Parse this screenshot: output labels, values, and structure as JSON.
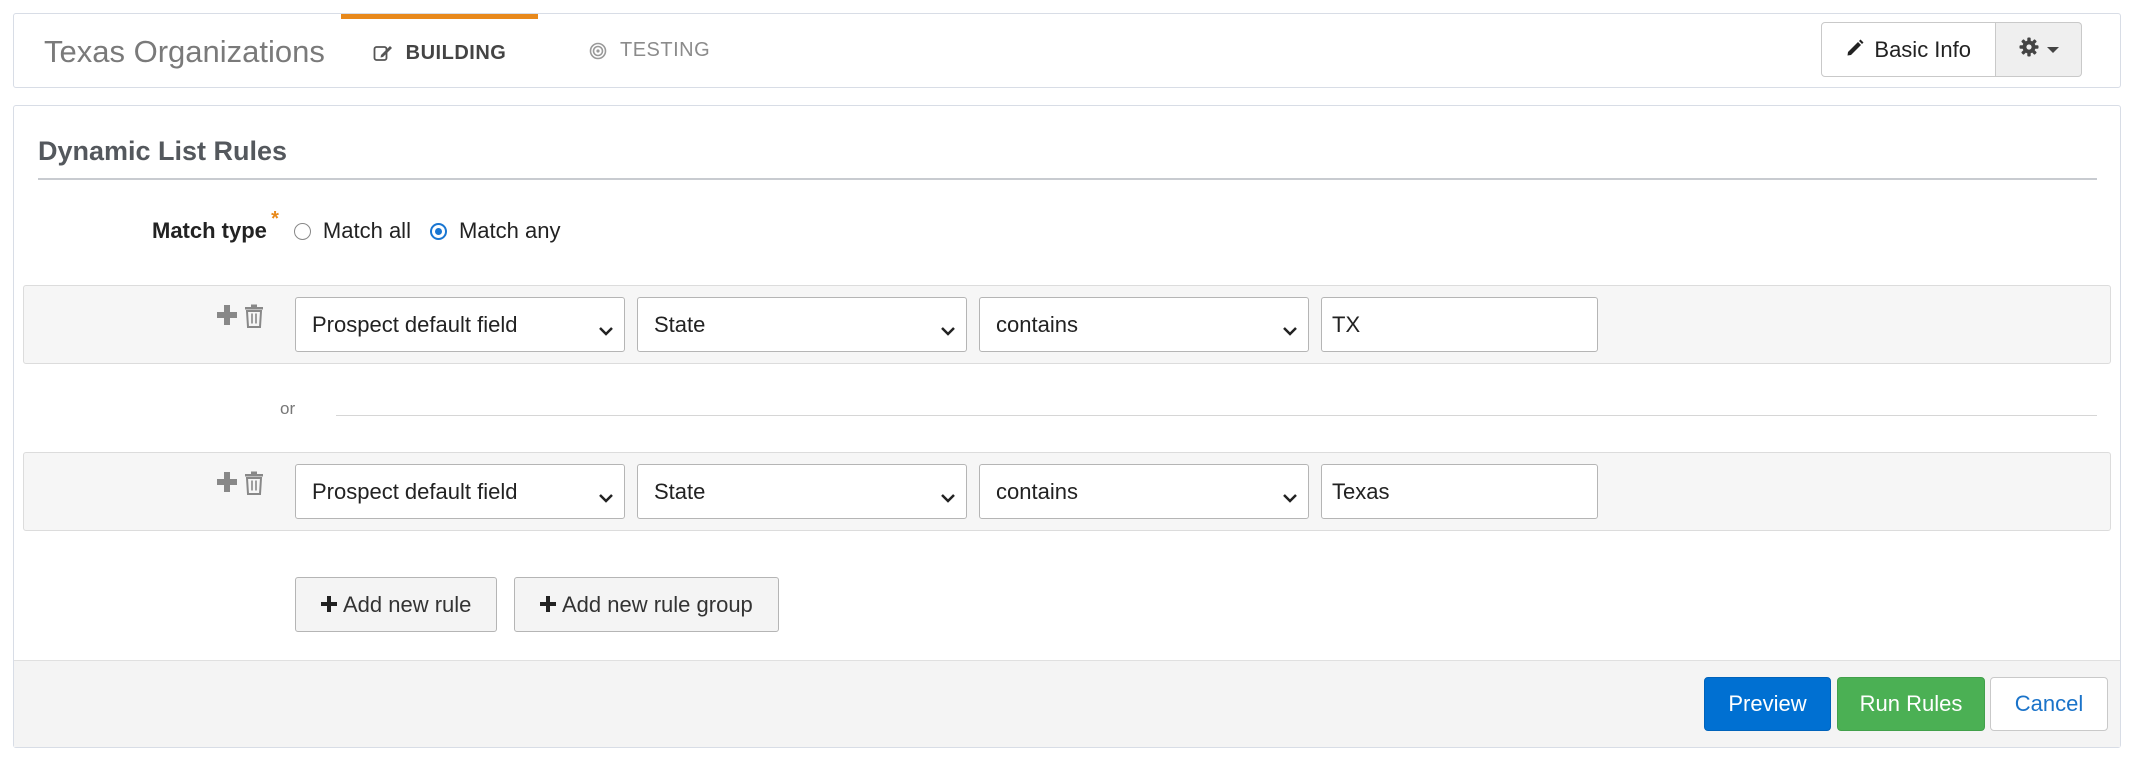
{
  "header": {
    "app_title": "Texas Organizations",
    "tabs": [
      {
        "label": "BUILDING",
        "icon": "edit-icon",
        "active": true
      },
      {
        "label": "TESTING",
        "icon": "target-icon",
        "active": false
      }
    ],
    "basic_info_label": "Basic Info",
    "accent_color": "#e8891b"
  },
  "panel": {
    "title": "Dynamic List Rules",
    "match_type": {
      "label": "Match type",
      "required_mark": "*",
      "options": [
        "Match all",
        "Match any"
      ],
      "selected": "Match any"
    },
    "rules": [
      {
        "field_type": "Prospect default field",
        "field": "State",
        "operator": "contains",
        "value": "TX"
      },
      {
        "field_type": "Prospect default field",
        "field": "State",
        "operator": "contains",
        "value": "Texas"
      }
    ],
    "separator": "or",
    "add_rule_label": "Add new rule",
    "add_rule_group_label": "Add new rule group"
  },
  "footer": {
    "preview_label": "Preview",
    "run_label": "Run Rules",
    "cancel_label": "Cancel",
    "colors": {
      "preview": "#0070d2",
      "run": "#4bb054"
    }
  }
}
